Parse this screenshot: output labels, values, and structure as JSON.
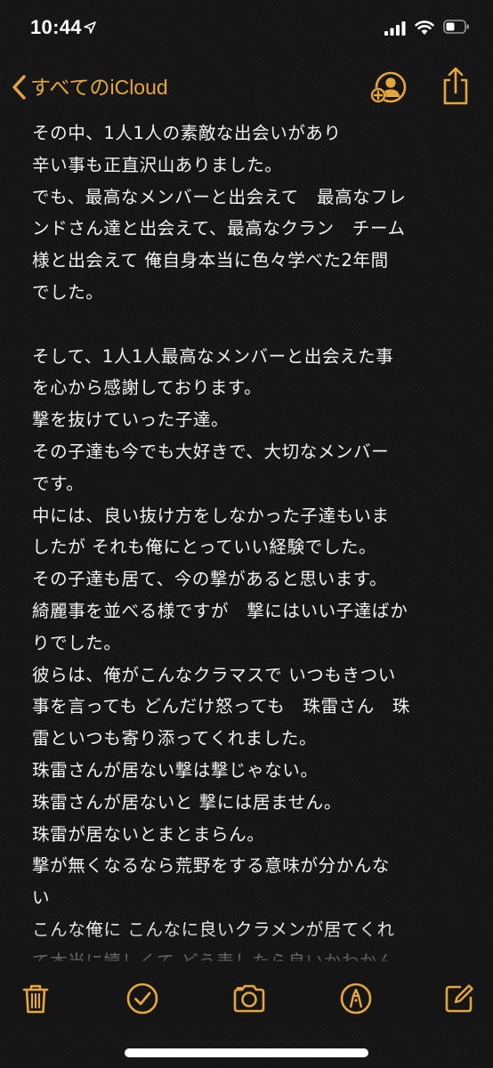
{
  "status_bar": {
    "time": "10:44",
    "icons": [
      "location-arrow-icon",
      "cellular-signal-icon",
      "wifi-icon",
      "battery-icon"
    ]
  },
  "nav": {
    "back_label": "すべてのiCloud",
    "actions": [
      "add-people-icon",
      "share-icon"
    ]
  },
  "note": {
    "lines": [
      "その中、1人1人の素敵な出会いがあり",
      "辛い事も正直沢山ありました。",
      "でも、最高なメンバーと出会えて　最高なフレ",
      "ンドさん達と出会えて、最高なクラン　チーム",
      "様と出会えて 俺自身本当に色々学べた2年間",
      "でした。",
      "",
      "そして、1人1人最高なメンバーと出会えた事",
      "を心から感謝しております。",
      "撃を抜けていった子達。",
      "その子達も今でも大好きで、大切なメンバー",
      "です。",
      "中には、良い抜け方をしなかった子達もいま",
      "したが それも俺にとっていい経験でした。",
      "その子達も居て、今の撃があると思います。",
      "綺麗事を並べる様ですが　撃にはいい子達ばか",
      "りでした。",
      "彼らは、俺がこんなクラマスで いつもきつい",
      "事を言っても どんだけ怒っても　珠雷さん　珠",
      "雷といつも寄り添ってくれました。",
      "珠雷さんが居ない撃は撃じゃない。",
      "珠雷さんが居ないと 撃には居ません。",
      "珠雷が居ないとまとまらん。",
      "撃が無くなるなら荒野をする意味が分かんな",
      "い",
      "こんな俺に こんなに良いクラメンが居てくれ",
      "て本当に嬉しくて どう表したら良いかわかん"
    ]
  },
  "toolbar": {
    "items": [
      "trash-icon",
      "checklist-icon",
      "camera-icon",
      "markup-pen-icon",
      "compose-icon"
    ]
  },
  "colors": {
    "accent": "#e6a73a",
    "background": "#151515",
    "text": "#f2f2f2"
  }
}
